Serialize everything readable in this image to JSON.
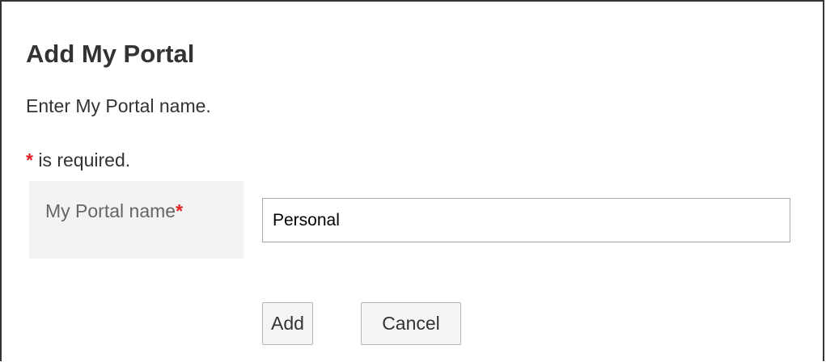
{
  "dialog": {
    "title": "Add My Portal",
    "instruction": "Enter My Portal name.",
    "required_note": {
      "marker": "*",
      "text": " is required."
    }
  },
  "form": {
    "portal_name": {
      "label": "My Portal name",
      "required_marker": "*",
      "value": "Personal",
      "placeholder": ""
    }
  },
  "buttons": {
    "add_label": "Add",
    "cancel_label": "Cancel"
  },
  "colors": {
    "required_marker": "#e02020",
    "label_cell_background": "#f3f3f3",
    "button_background": "#f5f5f5"
  }
}
